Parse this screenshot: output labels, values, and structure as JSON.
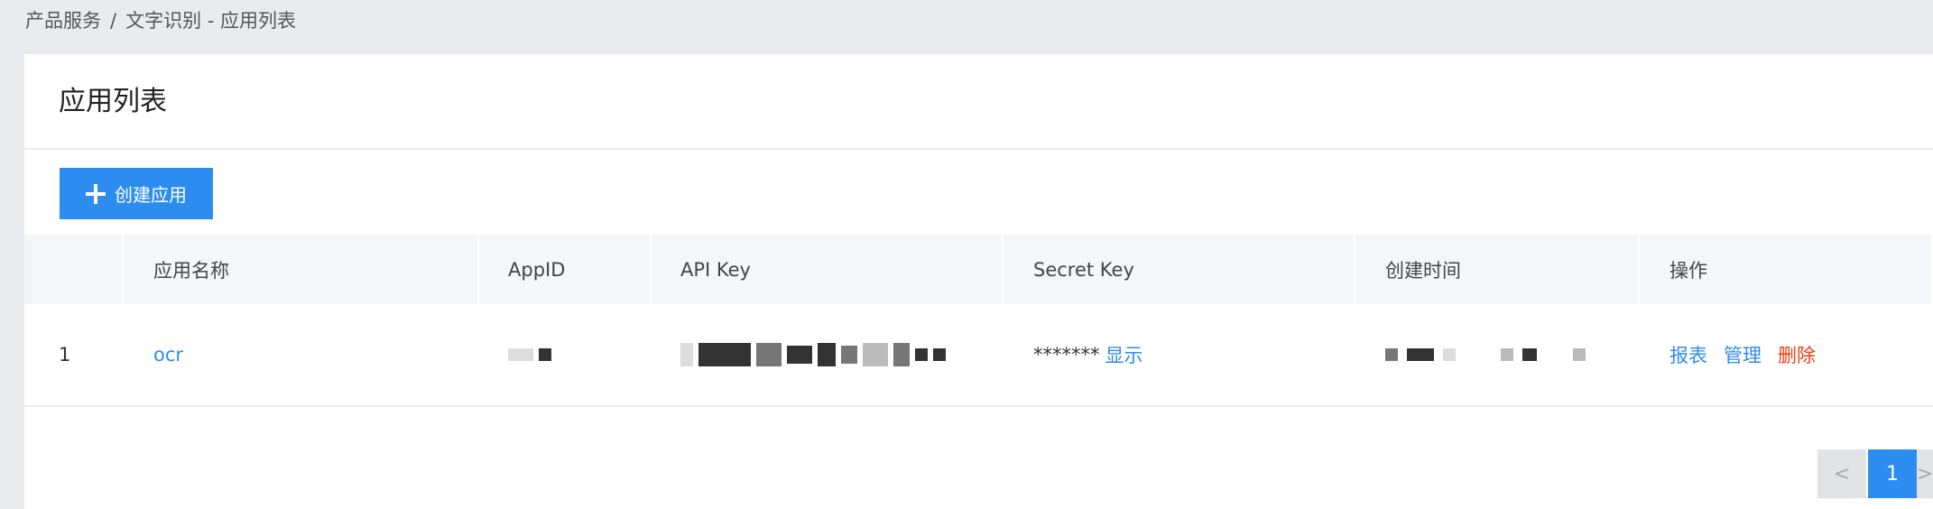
{
  "breadcrumb": {
    "root": "产品服务",
    "separator": "/",
    "current": "文字识别 - 应用列表"
  },
  "panel": {
    "title": "应用列表",
    "create_button": "创建应用"
  },
  "table": {
    "headers": {
      "name": "应用名称",
      "appid": "AppID",
      "apikey": "API Key",
      "secret": "Secret Key",
      "created": "创建时间",
      "ops": "操作"
    },
    "rows": [
      {
        "index": "1",
        "name": "ocr",
        "secret_masked": "*******",
        "show_label": "显示",
        "op_report": "报表",
        "op_manage": "管理",
        "op_delete": "删除"
      }
    ]
  },
  "pagination": {
    "prev": "<",
    "current": "1",
    "next": ">"
  },
  "colors": {
    "primary": "#2d8cf0",
    "danger": "#ed3f14"
  }
}
